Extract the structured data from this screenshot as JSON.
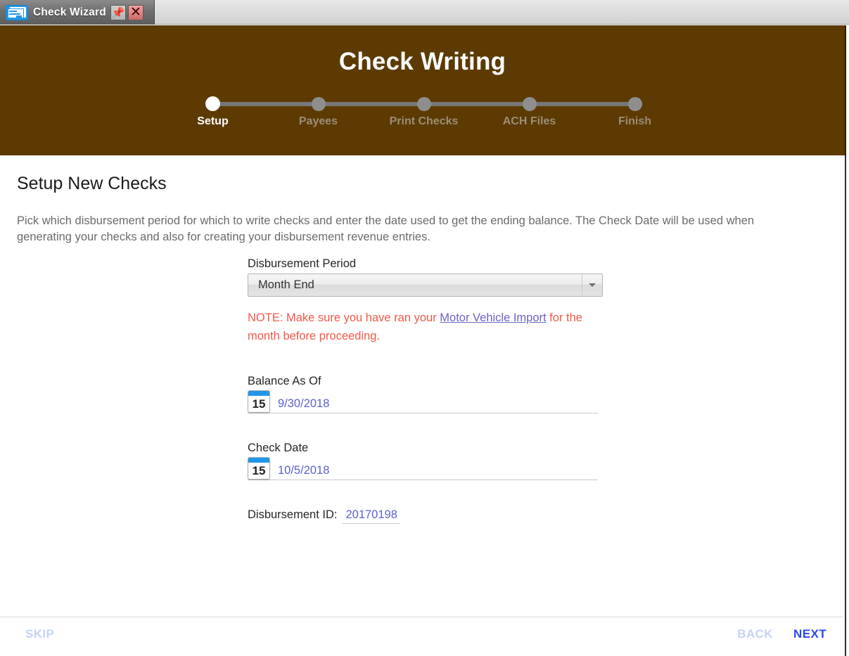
{
  "window": {
    "tab_title": "Check Wizard",
    "tab_icon": "check-document-icon",
    "pin_icon": "pushpin-icon",
    "close_icon": "close-icon"
  },
  "wizard": {
    "title": "Check Writing",
    "steps": [
      {
        "label": "Setup",
        "active": true
      },
      {
        "label": "Payees",
        "active": false
      },
      {
        "label": "Print Checks",
        "active": false
      },
      {
        "label": "ACH Files",
        "active": false
      },
      {
        "label": "Finish",
        "active": false
      }
    ]
  },
  "page": {
    "title": "Setup New Checks",
    "description": "Pick which disbursement period for which to write checks and enter the date used to get the ending balance.  The Check Date will be used when generating your checks and also for creating your disbursement revenue entries."
  },
  "form": {
    "disbursement_period": {
      "label": "Disbursement Period",
      "value": "Month End",
      "caret_icon": "chevron-down-icon"
    },
    "note": {
      "prefix": "NOTE: Make sure you have ran your ",
      "link": "Motor Vehicle Import",
      "suffix": " for the month before proceeding."
    },
    "balance_as_of": {
      "label": "Balance As Of",
      "value": "9/30/2018",
      "calendar_day": "15",
      "calendar_icon": "calendar-icon"
    },
    "check_date": {
      "label": "Check Date",
      "value": "10/5/2018",
      "calendar_day": "15",
      "calendar_icon": "calendar-icon"
    },
    "disbursement_id": {
      "label": "Disbursement ID:",
      "value": "20170198"
    }
  },
  "footer": {
    "skip": "SKIP",
    "back": "BACK",
    "next": "NEXT"
  },
  "colors": {
    "header_brown": "#5c3a02",
    "link_purple": "#6a62c8",
    "note_red": "#f4574a",
    "value_blue": "#5a5fd0",
    "next_blue": "#2b47ee",
    "disabled_blue": "#c5d2f5",
    "calendar_blue": "#2196e8"
  }
}
